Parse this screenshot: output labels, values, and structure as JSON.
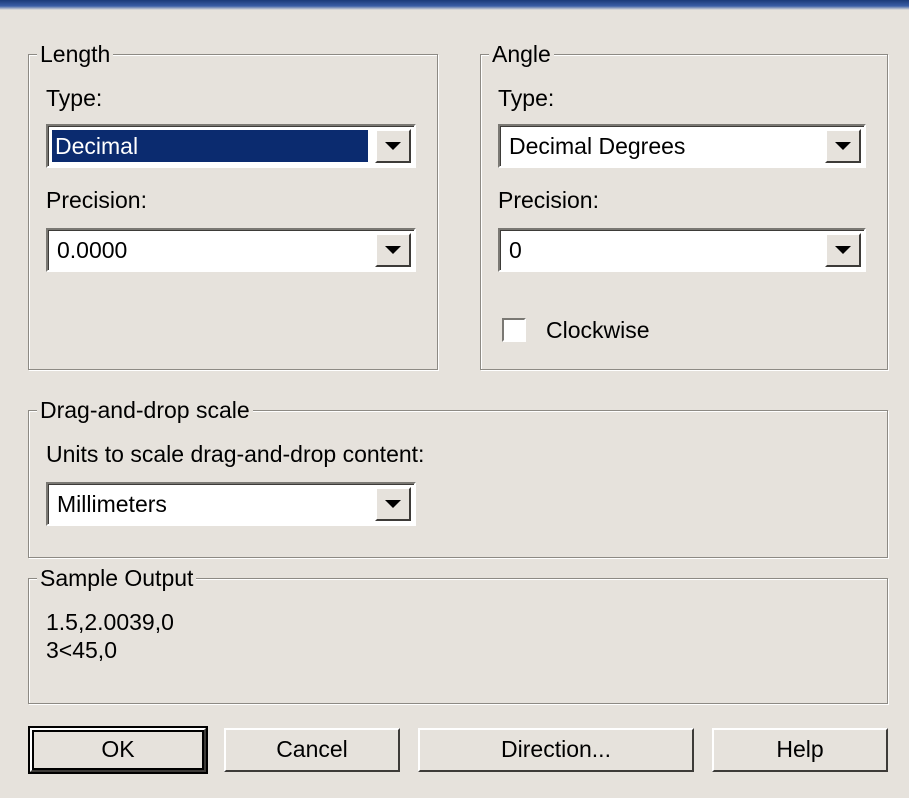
{
  "length": {
    "legend": "Length",
    "type_label": "Type:",
    "type_value": "Decimal",
    "precision_label": "Precision:",
    "precision_value": "0.0000"
  },
  "angle": {
    "legend": "Angle",
    "type_label": "Type:",
    "type_value": "Decimal Degrees",
    "precision_label": "Precision:",
    "precision_value": "0",
    "clockwise_label": "Clockwise",
    "clockwise_checked": false
  },
  "scale": {
    "legend": "Drag-and-drop scale",
    "units_label": "Units to scale drag-and-drop content:",
    "units_value": "Millimeters"
  },
  "sample": {
    "legend": "Sample Output",
    "line1": "1.5,2.0039,0",
    "line2": "3<45,0"
  },
  "buttons": {
    "ok": "OK",
    "cancel": "Cancel",
    "direction": "Direction...",
    "help": "Help"
  },
  "icons": {
    "dropdown": "chevron-down-icon"
  },
  "colors": {
    "selection": "#0b2b6f",
    "face": "#e6e2dc"
  }
}
